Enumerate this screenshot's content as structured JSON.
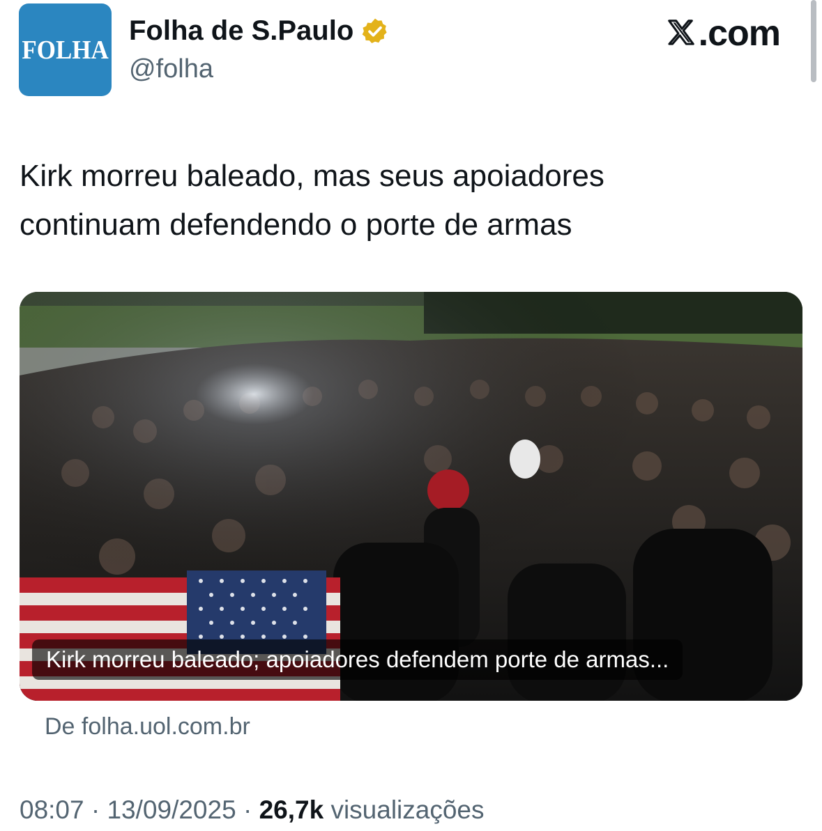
{
  "header": {
    "avatar_text": "FOLHA",
    "display_name": "Folha de S.Paulo",
    "handle": "@folha",
    "site_label": ".com",
    "verified_icon": "verified-badge-gold",
    "logo_icon": "x-logo"
  },
  "tweet": {
    "text_line1": "Kirk morreu baleado, mas seus apoiadores",
    "text_line2": "continuam defendendo o porte de armas"
  },
  "card": {
    "image_description_icon": "crowd-photo",
    "caption": "Kirk morreu baleado; apoiadores defendem porte de armas...",
    "source": "De folha.uol.com.br"
  },
  "meta": {
    "time": "08:07",
    "separator": "·",
    "date": "13/09/2025",
    "views_count": "26,7k",
    "views_label": "visualizações"
  },
  "colors": {
    "brand_blue": "#2b86c0",
    "verified_gold": "#e3b21a",
    "secondary_text": "#536471"
  }
}
